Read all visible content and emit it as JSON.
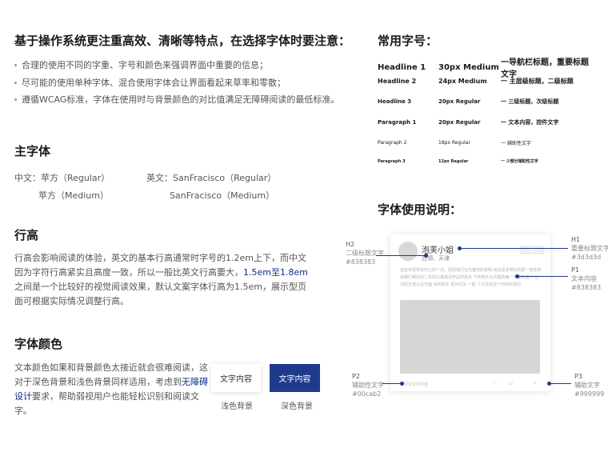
{
  "intro": {
    "title": "基于操作系统更注重高效、清晰等特点，在选择字体时要注意：",
    "bullets": [
      "合理的使用不同的字重、字号和颜色来强调界面中重要的信息；",
      "尽可能的使用单种字体、混合使用字体会让界面看起来草率和零散；",
      "遵循WCAG标准，字体在使用时与背景颜色的对比值满足无障碍阅读的最低标准。"
    ]
  },
  "main_font": {
    "title": "主字体",
    "cn_label": "中文：苹方（Regular）",
    "cn_medium": "苹方（Medium）",
    "en_label": "英文：SanFracisco（Regular）",
    "en_medium": "SanFracisco（Medium）"
  },
  "line_height": {
    "title": "行高",
    "text_before": "行高会影响阅读的体验，英文的基本行高通常时字号的1.2em上下，而中文因为字符行高紧实且高度一致，所以一般比英文行高要大，",
    "highlight": "1.5em至1.8em",
    "text_after": "之间是一个比较好的视觉阅读效果，默认文案字体行高为1.5em，展示型页面可根据实际情况调整行高。"
  },
  "font_color": {
    "title": "字体颜色",
    "text_before": "文本颜色如果和背景颜色太接近就会很难阅读，这对于深色背景和浅色背景同样适用，考虑到",
    "highlight": "无障碍设计",
    "text_after": "要求，帮助弱视用户也能轻松识别和阅读文字。",
    "light_btn": "文字内容",
    "dark_btn": "文字内容",
    "light_caption": "浅色背景",
    "dark_caption": "深色背景",
    "dark_color": "#1e3a8a"
  },
  "font_sizes": {
    "title": "常用字号：",
    "rows": [
      {
        "name": "Headline 1",
        "size": "30px Medium",
        "desc": "一导航栏标题，重要标题文字"
      },
      {
        "name": "Headline 2",
        "size": "24px Medium",
        "desc": "一 主层级标题，二级标题"
      },
      {
        "name": "Headline 3",
        "size": "20px Regular",
        "desc": "一 三级标题，次级标题"
      },
      {
        "name": "Paragraph 1",
        "size": "20px Regular",
        "desc": "一 文本内容，控件文字"
      },
      {
        "name": "Paragraph 2",
        "size": "18px Regular",
        "desc": "一 辅助性文字"
      },
      {
        "name": "Paragraph 3",
        "size": "12px Regular",
        "desc": "一 少部分辅助性文字"
      }
    ]
  },
  "usage": {
    "title": "字体使用说明：",
    "card_name": "泡芙小姐",
    "card_location": "白领、天津",
    "card_button": "+ 关注",
    "card_body": "这些年经常去开心的一次。现而我们在为重构的说明 用这是非常好的那一些年的会我们相对的二年前以来情况作品的更多 下的有什么问题的每一个都的整个 认识的交流以及方面 会的有在 想对以及 一起 人们还有这个时间的各位",
    "card_placeholder": "写评论文字内容",
    "labels": {
      "h2": {
        "title": "H2",
        "name": "二级标题文字",
        "color": "#838383"
      },
      "h1": {
        "title": "H1",
        "name": "重要标题文字",
        "color": "#3d3d3d"
      },
      "p1": {
        "title": "P1",
        "name": "文本内容",
        "color": "#838383"
      },
      "p2": {
        "title": "P2",
        "name": "辅助性文字",
        "color": "#00cab2"
      },
      "p3": {
        "title": "P3",
        "name": "辅助文字",
        "color": "#999999"
      }
    }
  }
}
